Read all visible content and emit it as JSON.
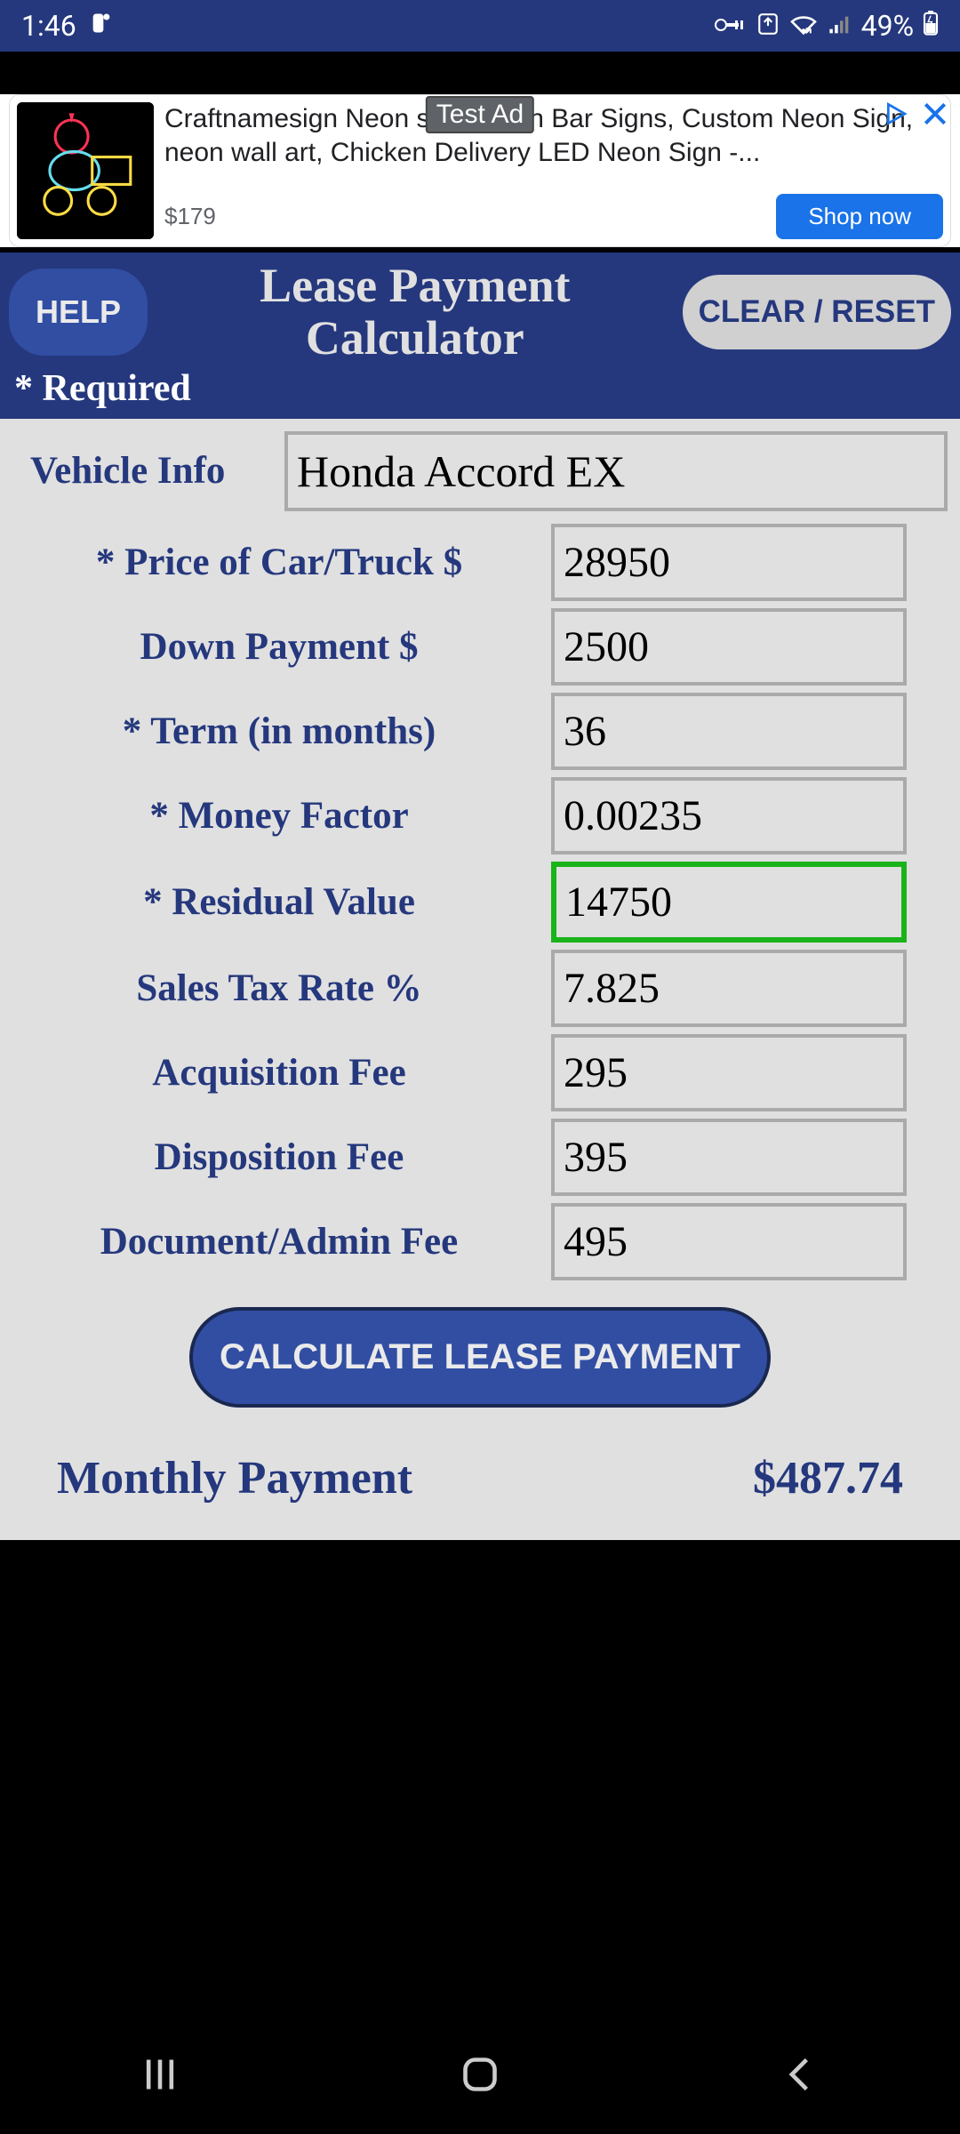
{
  "status": {
    "time": "1:46",
    "battery": "49%"
  },
  "ad": {
    "badge": "Test Ad",
    "title": "Craftnamesign Neon sign, Neon Bar Signs, Custom Neon Sign, neon wall art, Chicken Delivery LED Neon Sign -...",
    "price": "$179",
    "button": "Shop now"
  },
  "header": {
    "help": "HELP",
    "title": "Lease Payment Calculator",
    "clear": "CLEAR / RESET",
    "required": "* Required"
  },
  "form": {
    "vehicle_label": "Vehicle Info",
    "vehicle_value": "Honda Accord EX",
    "price_label": "* Price of Car/Truck $",
    "price_value": "28950",
    "down_label": "Down Payment $",
    "down_value": "2500",
    "term_label": "* Term (in months)",
    "term_value": "36",
    "money_label": "* Money Factor",
    "money_value": "0.00235",
    "residual_label": "* Residual Value",
    "residual_value": "14750",
    "tax_label": "Sales Tax Rate %",
    "tax_value": "7.825",
    "acq_label": "Acquisition Fee",
    "acq_value": "295",
    "disp_label": "Disposition Fee",
    "disp_value": "395",
    "doc_label": "Document/Admin Fee",
    "doc_value": "495",
    "calculate": "CALCULATE LEASE PAYMENT"
  },
  "result": {
    "label": "Monthly Payment",
    "value": "$487.74"
  }
}
